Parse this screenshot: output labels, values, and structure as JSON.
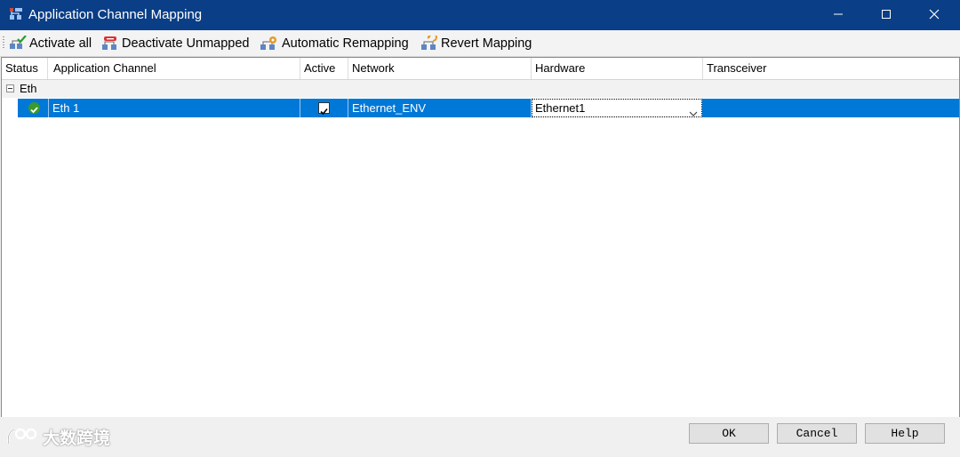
{
  "window": {
    "title": "Application Channel Mapping",
    "icon": "channel-mapping-icon",
    "controls": [
      "minimize-icon",
      "maximize-icon",
      "close-icon"
    ]
  },
  "toolbar": {
    "activate_all": "Activate all",
    "deactivate_unmapped": "Deactivate Unmapped",
    "automatic_remapping": "Automatic Remapping",
    "revert_mapping": "Revert Mapping"
  },
  "grid": {
    "columns": {
      "status": "Status",
      "application_channel": "Application Channel",
      "active": "Active",
      "network": "Network",
      "hardware": "Hardware",
      "transceiver": "Transceiver"
    },
    "group": {
      "label": "Eth",
      "expanded": true
    },
    "rows": [
      {
        "status": "ok",
        "application_channel": "Eth 1",
        "active": true,
        "network": "Ethernet_ENV",
        "hardware": "Ethernet1",
        "transceiver": ""
      }
    ]
  },
  "buttons": {
    "ok": "OK",
    "cancel": "Cancel",
    "help": "Help"
  },
  "watermark": {
    "text": "大数跨境"
  },
  "colors": {
    "titlebar": "#0a3e86",
    "selection": "#0078d7",
    "status_ok": "#3a9a2a"
  }
}
